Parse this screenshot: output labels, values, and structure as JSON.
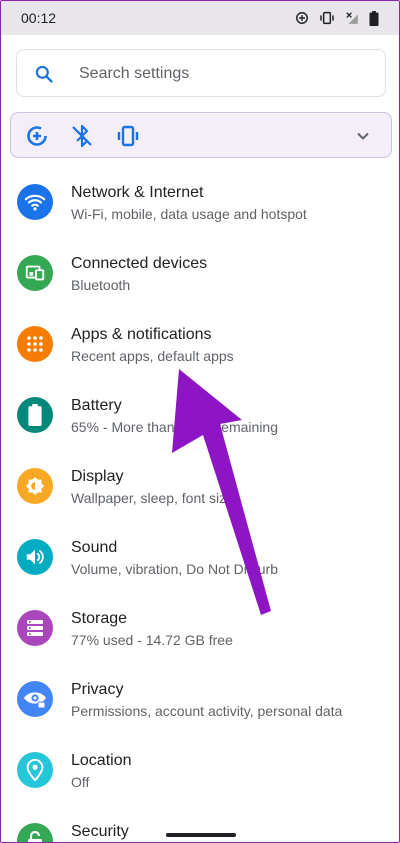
{
  "status_bar": {
    "time": "00:12"
  },
  "search": {
    "placeholder": "Search settings"
  },
  "settings": [
    {
      "title": "Network & Internet",
      "subtitle": "Wi-Fi, mobile, data usage and hotspot",
      "color": "#1a73e8",
      "icon": "wifi-icon"
    },
    {
      "title": "Connected devices",
      "subtitle": "Bluetooth",
      "color": "#34a853",
      "icon": "devices-icon"
    },
    {
      "title": "Apps & notifications",
      "subtitle": "Recent apps, default apps",
      "color": "#f57c00",
      "icon": "apps-grid-icon"
    },
    {
      "title": "Battery",
      "subtitle": "65% - More than 1 day remaining",
      "color": "#00897b",
      "icon": "battery-icon"
    },
    {
      "title": "Display",
      "subtitle": "Wallpaper, sleep, font size",
      "color": "#f9a825",
      "icon": "brightness-icon"
    },
    {
      "title": "Sound",
      "subtitle": "Volume, vibration, Do Not Disturb",
      "color": "#00acc1",
      "icon": "volume-icon"
    },
    {
      "title": "Storage",
      "subtitle": "77% used - 14.72 GB free",
      "color": "#ab47bc",
      "icon": "storage-icon"
    },
    {
      "title": "Privacy",
      "subtitle": "Permissions, account activity, personal data",
      "color": "#4285f4",
      "icon": "privacy-eye-icon"
    },
    {
      "title": "Location",
      "subtitle": "Off",
      "color": "#26c6da",
      "icon": "location-pin-icon"
    },
    {
      "title": "Security",
      "subtitle": "",
      "color": "#34a853",
      "icon": "lock-icon"
    }
  ],
  "annotation": {
    "arrow_color": "#8e15c4"
  }
}
